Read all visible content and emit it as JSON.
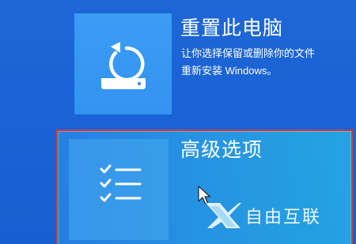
{
  "reset_option": {
    "title": "重置此电脑",
    "description_line1": "让你选择保留或删除你的文件",
    "description_line2": "重新安装 Windows。",
    "icon": "reset-pc-icon"
  },
  "advanced_option": {
    "title": "高级选项",
    "icon": "checklist-icon"
  },
  "watermark": {
    "text": "自由互联",
    "icon": "x-logo"
  },
  "colors": {
    "background": "#1a63d6",
    "tile": "#3394f1",
    "highlight_border": "#d23b32"
  }
}
